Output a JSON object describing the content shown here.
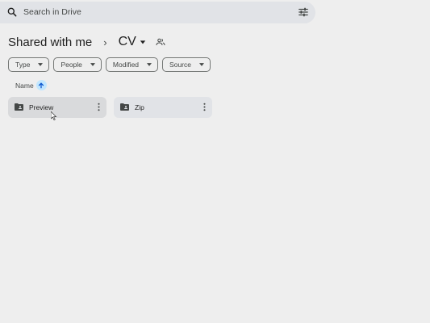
{
  "search": {
    "placeholder": "Search in Drive",
    "icon": "search-icon",
    "options_icon": "tune-icon"
  },
  "breadcrumb": {
    "root": "Shared with me",
    "separator": "›",
    "current": "CV"
  },
  "filters": [
    {
      "label": "Type"
    },
    {
      "label": "People"
    },
    {
      "label": "Modified"
    },
    {
      "label": "Source"
    }
  ],
  "sort": {
    "label": "Name",
    "direction": "ascending"
  },
  "folders": [
    {
      "name": "Preview"
    },
    {
      "name": "Zip"
    }
  ],
  "colors": {
    "accent": "#c2e7ff",
    "background": "#eeeeee",
    "search_bg": "#e1e3e7"
  }
}
